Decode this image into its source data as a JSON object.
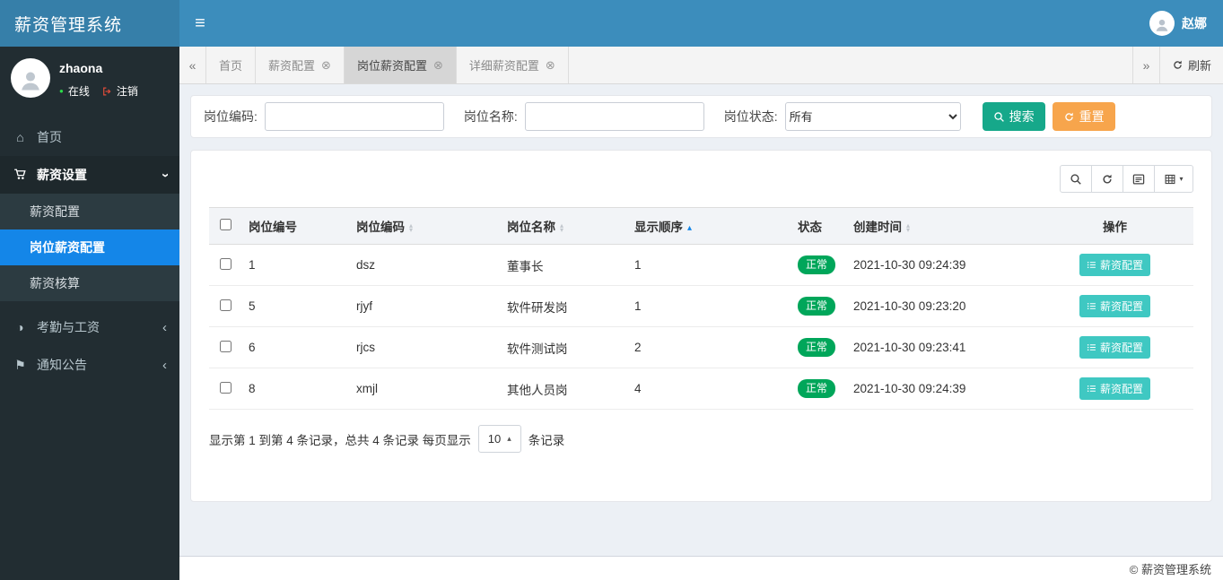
{
  "app": {
    "title": "薪资管理系统"
  },
  "header": {
    "user_name": "赵娜"
  },
  "colors": {
    "header-blue": "#3c8dbc",
    "logo-blue": "#367fa9",
    "sidebar-dark": "#222d32",
    "submenu-dark": "#2c3b41",
    "active-blue": "#1486e8",
    "badge-green": "#00a65a",
    "search-teal": "#16a88a",
    "reset-orange": "#f7a54c",
    "action-teal": "#3fc8c2",
    "content-bg": "#ecf0f5"
  },
  "glyphs": {
    "hamburger": "≡",
    "home": "⌂",
    "adjust": "◑",
    "flag": "⚑",
    "chevron": "‹",
    "dot": "●",
    "close": "⊗",
    "caret_up": "▴",
    "caret_down": "▾",
    "scroll_left": "«",
    "scroll_right": "»"
  },
  "sidebar": {
    "user": {
      "name": "zhaona",
      "status": "在线",
      "logout": "注销"
    },
    "items": [
      {
        "label": "首页"
      },
      {
        "label": "薪资设置",
        "children": [
          {
            "label": "薪资配置"
          },
          {
            "label": "岗位薪资配置",
            "active": true
          },
          {
            "label": "薪资核算"
          }
        ]
      },
      {
        "label": "考勤与工资"
      },
      {
        "label": "通知公告"
      }
    ]
  },
  "tabs": {
    "items": [
      {
        "label": "首页",
        "closable": false
      },
      {
        "label": "薪资配置",
        "closable": true
      },
      {
        "label": "岗位薪资配置",
        "closable": true,
        "active": true
      },
      {
        "label": "详细薪资配置",
        "closable": true
      }
    ],
    "refresh_label": "刷新"
  },
  "search": {
    "code_label": "岗位编码:",
    "code_value": "",
    "name_label": "岗位名称:",
    "name_value": "",
    "status_label": "岗位状态:",
    "status_value": "所有",
    "search_label": "搜索",
    "reset_label": "重置"
  },
  "table": {
    "columns": [
      {
        "label": "岗位编号",
        "sortable": false
      },
      {
        "label": "岗位编码",
        "sortable": true
      },
      {
        "label": "岗位名称",
        "sortable": true
      },
      {
        "label": "显示顺序",
        "sortable": true,
        "sorted": "asc"
      },
      {
        "label": "状态",
        "sortable": false
      },
      {
        "label": "创建时间",
        "sortable": true
      },
      {
        "label": "操作",
        "sortable": false
      }
    ],
    "rows": [
      {
        "post_id": "1",
        "code": "dsz",
        "name": "董事长",
        "order": "1",
        "status": "正常",
        "created": "2021-10-30 09:24:39",
        "action": "薪资配置"
      },
      {
        "post_id": "5",
        "code": "rjyf",
        "name": "软件研发岗",
        "order": "1",
        "status": "正常",
        "created": "2021-10-30 09:23:20",
        "action": "薪资配置"
      },
      {
        "post_id": "6",
        "code": "rjcs",
        "name": "软件测试岗",
        "order": "2",
        "status": "正常",
        "created": "2021-10-30 09:23:41",
        "action": "薪资配置"
      },
      {
        "post_id": "8",
        "code": "xmjl",
        "name": "其他人员岗",
        "order": "4",
        "status": "正常",
        "created": "2021-10-30 09:24:39",
        "action": "薪资配置"
      }
    ],
    "pagination": {
      "info": "显示第 1 到第 4 条记录，总共 4 条记录 每页显示",
      "page_size": "10",
      "suffix": "条记录"
    }
  },
  "footer": {
    "text": "© 薪资管理系统"
  }
}
